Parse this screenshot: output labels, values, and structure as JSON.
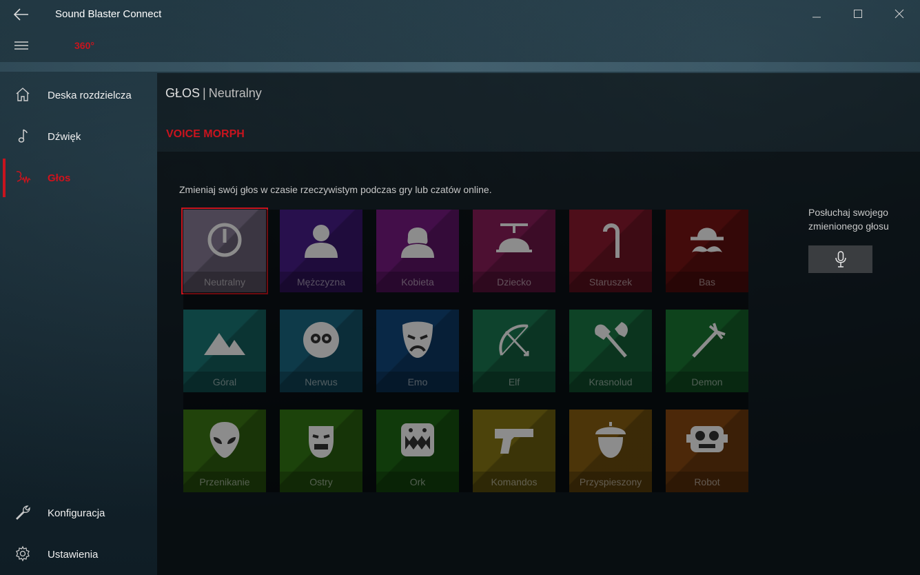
{
  "window": {
    "title": "Sound Blaster Connect",
    "logo_text": "360°"
  },
  "sidebar": {
    "items": [
      {
        "label": "Deska rozdzielcza",
        "icon": "home-icon"
      },
      {
        "label": "Dźwięk",
        "icon": "music-note-icon"
      },
      {
        "label": "Głos",
        "icon": "voice-icon",
        "active": true
      }
    ],
    "bottom_items": [
      {
        "label": "Konfiguracja",
        "icon": "wrench-icon"
      },
      {
        "label": "Ustawienia",
        "icon": "gear-icon"
      }
    ]
  },
  "header": {
    "section": "GŁOS",
    "separator": "|",
    "current": "Neutralny"
  },
  "voice_morph": {
    "title": "VOICE MORPH",
    "description": "Zmieniaj swój głos w czasie rzeczywistym podczas gry lub czatów online.",
    "selected": "Neutralny",
    "tiles": [
      {
        "label": "Neutralny",
        "icon": "power-icon",
        "color": "#8a7f9a"
      },
      {
        "label": "Mężczyzna",
        "icon": "man-icon",
        "color": "#4a1e8c"
      },
      {
        "label": "Kobieta",
        "icon": "woman-icon",
        "color": "#7a1a86"
      },
      {
        "label": "Dziecko",
        "icon": "propeller-hat-icon",
        "color": "#8c1e5c"
      },
      {
        "label": "Staruszek",
        "icon": "cane-icon",
        "color": "#8e1a30"
      },
      {
        "label": "Bas",
        "icon": "bowler-mustache-icon",
        "color": "#7a1414"
      },
      {
        "label": "Góral",
        "icon": "mountains-icon",
        "color": "#1a7a78"
      },
      {
        "label": "Nerwus",
        "icon": "nervous-face-icon",
        "color": "#1a6a86"
      },
      {
        "label": "Emo",
        "icon": "sad-mask-icon",
        "color": "#124a80"
      },
      {
        "label": "Elf",
        "icon": "bow-arrow-icon",
        "color": "#1a7a52"
      },
      {
        "label": "Krasnolud",
        "icon": "axe-icon",
        "color": "#1a7a46"
      },
      {
        "label": "Demon",
        "icon": "trident-icon",
        "color": "#1a7a34"
      },
      {
        "label": "Przenikanie",
        "icon": "alien-icon",
        "color": "#3c7a14"
      },
      {
        "label": "Ostry",
        "icon": "ogre-head-icon",
        "color": "#347a14"
      },
      {
        "label": "Ork",
        "icon": "monster-mouth-icon",
        "color": "#1e6a14"
      },
      {
        "label": "Komandos",
        "icon": "pistol-icon",
        "color": "#8a7a14"
      },
      {
        "label": "Przyspieszony",
        "icon": "acorn-icon",
        "color": "#8a6212"
      },
      {
        "label": "Robot",
        "icon": "robot-icon",
        "color": "#8a4a12"
      }
    ]
  },
  "preview": {
    "label": "Posłuchaj swojego zmienionego głosu",
    "button_icon": "microphone-icon"
  }
}
